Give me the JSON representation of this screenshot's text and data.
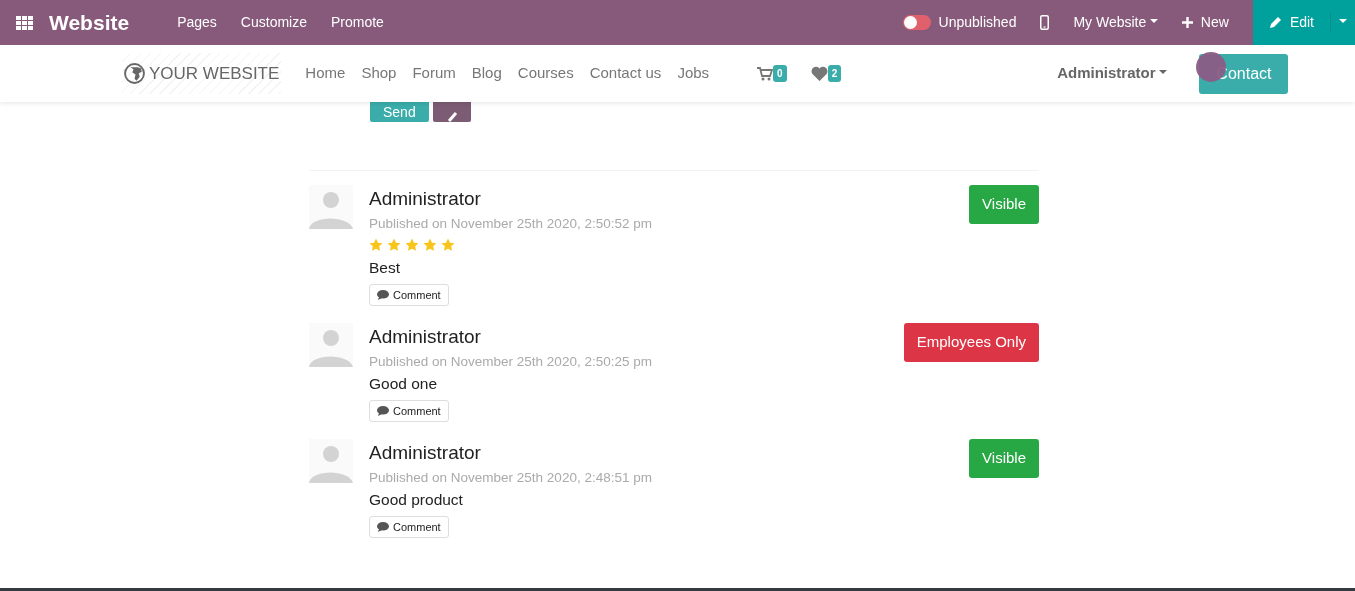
{
  "topbar": {
    "app_title": "Website",
    "menu": [
      "Pages",
      "Customize",
      "Promote"
    ],
    "publish_toggle": {
      "label": "Unpublished",
      "on": false
    },
    "website_menu": "My Website",
    "new_button": "New",
    "edit_button": "Edit"
  },
  "site_nav": {
    "logo": "YOUR WEBSITE",
    "links": [
      "Home",
      "Shop",
      "Forum",
      "Blog",
      "Courses",
      "Contact us",
      "Jobs"
    ],
    "cart_count": "0",
    "wishlist_count": "2",
    "user_menu": "Administrator",
    "contact_button": "Contact"
  },
  "composer": {
    "send_button": "Send"
  },
  "reviews": [
    {
      "author": "Administrator",
      "published": "Published on November 25th 2020, 2:50:52 pm",
      "stars": 5,
      "text": "Best",
      "comment_button": "Comment",
      "status": {
        "kind": "visible",
        "label": "Visible"
      }
    },
    {
      "author": "Administrator",
      "published": "Published on November 25th 2020, 2:50:25 pm",
      "text": "Good one",
      "comment_button": "Comment",
      "status": {
        "kind": "employees",
        "label": "Employees Only"
      }
    },
    {
      "author": "Administrator",
      "published": "Published on November 25th 2020, 2:48:51 pm",
      "text": "Good product",
      "comment_button": "Comment",
      "status": {
        "kind": "visible",
        "label": "Visible"
      }
    }
  ]
}
